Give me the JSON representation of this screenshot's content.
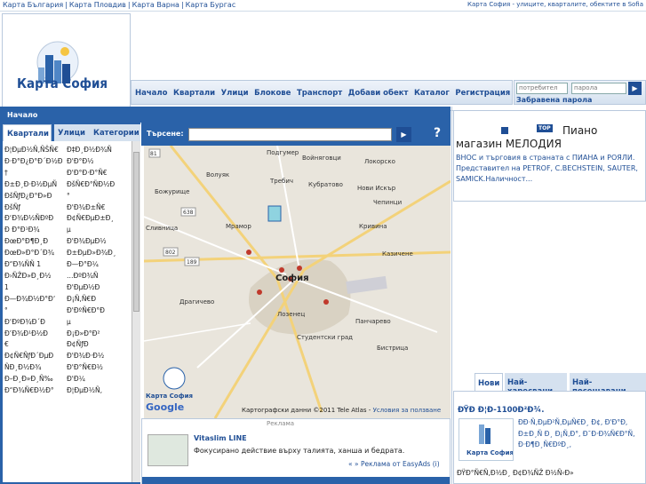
{
  "topbar": {
    "links": [
      "Карта България",
      "Карта Пловдив",
      "Карта Варна",
      "Карта Бургас"
    ],
    "tagline": "Карта София - улиците, кварталите, обектите в Sofia"
  },
  "logo": {
    "title": "Карта София"
  },
  "nav": {
    "items": [
      "Начало",
      "Квартали",
      "Улици",
      "Блокове",
      "Транспорт",
      "Добави обект",
      "Каталог",
      "Регистрация"
    ]
  },
  "login": {
    "user_placeholder": "потребител",
    "pass_placeholder": "парола",
    "forgot_label": "Забравена парола"
  },
  "breadcrumb": "Начало",
  "left_tabs": [
    "Квартали",
    "Улици",
    "Категории"
  ],
  "left_list": {
    "col1": [
      "Ð¦ÐµÐ½Ñ‚ÑŠÑ€",
      "Ð·Ð°Ð¿Ð°Ð´Ð½Ð",
      "†",
      "Ð±Ð¸Ð·Ð½ÐµÑ",
      "ÐšÑƒÐ¿Ð°Ð»Ð",
      "ÐšÑƒ",
      "Ð‘Ð¾Ð½ÑÐºÐ",
      "Ð Ð°Ð¹Ð¾",
      "ÐœÐ°Ð¶Ð¸Ð",
      "ÐœÐ»Ð°Ð´Ð¾",
      "Ð“Ð¾ÑÑ 1",
      "Ð›ÑŽÐ»Ð¸Ð½",
      "1",
      "Ð—Ð¾Ð½Ð°Ð‘",
      "°",
      "Ð‘ÐºÐ¾Ð´Ð",
      "Ð’Ð¾Ð¹Ð½Ð",
      "€",
      "Ð¢Ñ€ÑƒÐ´ÐµÐ",
      "ÑÐ¸Ð½Ð¾",
      "Ð–Ð¸Ð»Ð¸Ñ‰",
      "Ð“Ð¾Ñ€Ð½Ð°"
    ],
    "col2": [
      "Ð‡Ð¸Ð½Ð¾Ñ",
      "Ð'Ð°Ð½",
      "Ð'Ð°Ð·Ð°Ñ€",
      "ÐšÑ€Ð°ÑÐ½Ð",
      "°",
      "Ð'Ð¾Ð±Ñ€",
      "Ð¢Ñ€ÐµÐ±Ð¸",
      "µ",
      "Ð'Ð¾ÐµÐ½",
      "Ð±ÐµÐ»Ð¾Ð¸",
      "Ð—Ð°Ð¼",
      "…ÐºÐ¾Ñ",
      "Ð'ÐµÐ½Ð",
      "Ð¡Ñ‚Ñ€Ð",
      "Ð'ÐºÑ€Ð°Ð",
      "µ",
      "Ð¡Ð»Ð°Ð²",
      "Ð¢ÑƒÐ",
      "Ð'Ð¾Ð·Ð½",
      "Ð'Ð°Ñ€Ð½",
      "Ð'Ð¼",
      "Ð¦ÐµÐ½Ñ‚"
    ]
  },
  "search": {
    "label": "Търсене:",
    "value": "",
    "help": "?"
  },
  "map": {
    "labels": [
      "Подгумер",
      "Войняговци",
      "Локорско",
      "Волуяк",
      "Требич",
      "Кубратово",
      "Чепинци",
      "Нови Искър",
      "Божурище",
      "Мрамор",
      "Кривина",
      "Казичене",
      "Драгичево",
      "София",
      "Панчарево",
      "Бистрица",
      "Лозенец",
      "Сливница",
      "Студентски град"
    ],
    "road_numbers": [
      "81",
      "16",
      "638",
      "802",
      "189",
      "18",
      "16"
    ],
    "credit": "Картографски данни ©2011 Tele Atlas -",
    "credit_link": "Условия за ползване",
    "badge": "Карта София",
    "google": "Google"
  },
  "ad": {
    "label": "Реклама",
    "title": "Vitaslim LINE",
    "text": "Фокусирано действие върху талията, ханша и бедрата.",
    "footer": "« » Реклама от EasyAds (i)"
  },
  "promo": {
    "top_badge": "TOP",
    "title_line1": "Пиано",
    "title_line2": "магазин МЕЛОДИЯ",
    "body": "ВНОС и търговия в страната с ПИАНА и РОЯЛИ. Представител на PETROF, C.BECHSTEIN, SAUTER, SAMICK.Наличност..."
  },
  "right_tabs": [
    "Нови",
    "Най-харесвани",
    "Най-посещавани"
  ],
  "right_item": {
    "heading": "ÐŸÐ Ð¦Ð-1100Ð²Ð¾.",
    "thumb_label": "Карта София",
    "text": "ÐÐ·Ñ‚ÐµÐ²Ñ‚ÐµÑ€Ð¸ Ð¢, Ð'Ð°Ð, Ð±Ð¸Ñ Ð¸ Ð¡Ñ‚Ð°, Ð¯Ð·Ð¾Ñ€Ð°Ñ, Ð·Ð¶Ð¸Ñ€ÐºÐ¸,",
    "text2": "ÐŸÐ°Ñ€Ñ‚Ð½Ð¸ Ð¢Ð¾ÑŽ Ð½Ñ‹Ð»"
  },
  "colors": {
    "brand": "#1f4e95",
    "panel": "#2a62a9"
  }
}
